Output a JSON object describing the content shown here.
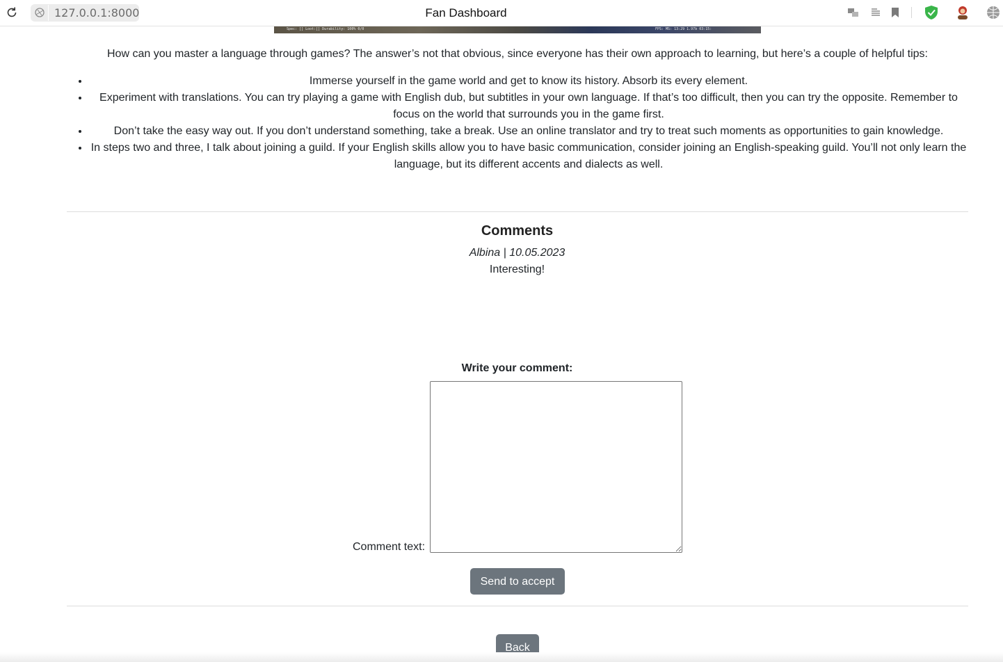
{
  "browser": {
    "url": "127.0.0.1:8000",
    "tab_title": "Fan Dashboard",
    "icons": [
      "reload-icon",
      "site-info-icon",
      "translate-icon",
      "reader-icon",
      "bookmark-icon",
      "shield-icon",
      "avatar-icon",
      "globe-icon"
    ],
    "colors": {
      "shield": "#3ab54a"
    }
  },
  "article": {
    "image_hud_left": "Spec: [] Loot:[]    Durability: 100%    0/0",
    "image_hud_right": "FPS: MS:    13:29    1.97b 03:15:",
    "intro": "How can you master a language through games? The answer’s not that obvious, since everyone has their own approach to learning, but here’s a couple of helpful tips:",
    "tips": [
      "Immerse yourself in the game world and get to know its history. Absorb its every element.",
      "Experiment with translations. You can try playing a game with English dub, but subtitles in your own language. If that’s too difficult, then you can try the opposite. Remember to focus on the world that surrounds you in the game first.",
      "Don’t take the easy way out. If you don’t understand something, take a break. Use an online translator and try to treat such moments as opportunities to gain knowledge.",
      "In steps two and three, I talk about joining a guild. If your English skills allow you to have basic communication, consider joining an English-speaking guild. You’ll not only learn the language, but its different accents and dialects as well."
    ]
  },
  "comments": {
    "title": "Comments",
    "items": [
      {
        "meta": "Albina | 10.05.2023",
        "text": "Interesting!"
      }
    ]
  },
  "form": {
    "heading": "Write your comment:",
    "field_label": "Comment text:",
    "textarea_value": "",
    "submit_label": "Send to accept"
  },
  "nav": {
    "back_label": "Back",
    "button_color": "#6c757d"
  }
}
